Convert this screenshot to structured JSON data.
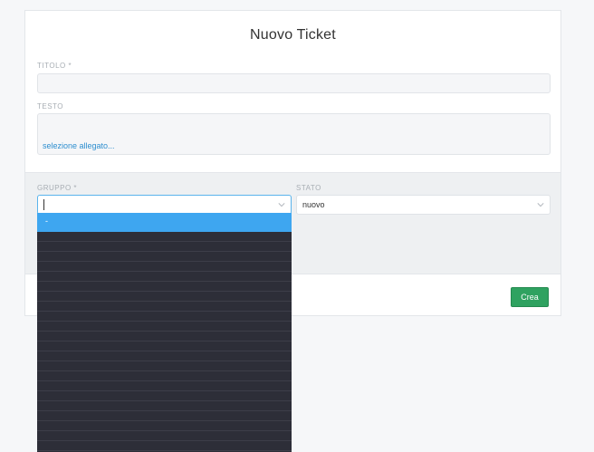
{
  "form": {
    "title": "Nuovo Ticket",
    "title_label": "TITOLO *",
    "title_value": "",
    "text_label": "TESTO",
    "attachment_link": "selezione allegato...",
    "group_label": "GRUPPO *",
    "group_value": "",
    "status_label": "STATO",
    "status_value": "nuovo",
    "create_button": "Crea"
  },
  "group_dropdown": {
    "options": [
      "-"
    ],
    "highlighted": "-",
    "highlight_color": "#3ea6f0",
    "background_color": "#2d2e38"
  },
  "colors": {
    "primary_button": "#2fa260",
    "link": "#2d8ecf",
    "focus_border": "#5ab4ec"
  }
}
